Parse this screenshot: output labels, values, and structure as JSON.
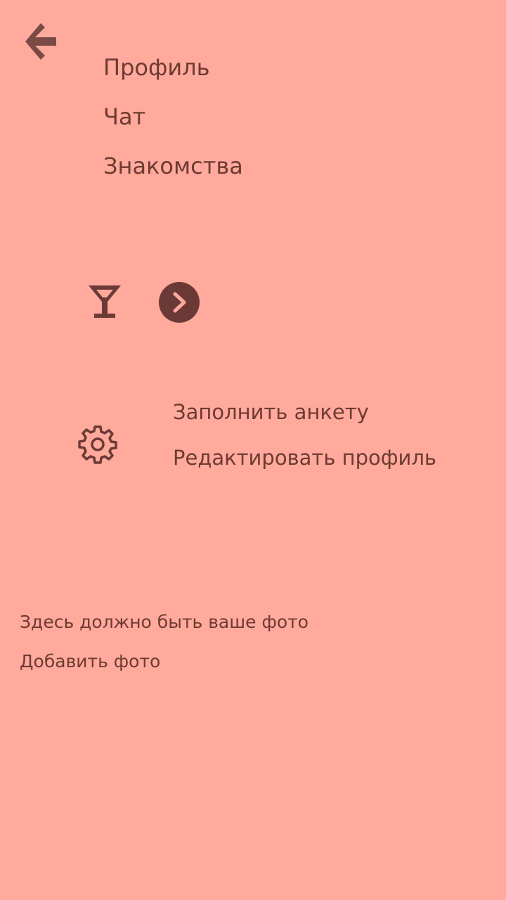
{
  "colors": {
    "background": "#ffaa9c",
    "text": "#6e3a33",
    "icon": "#7a4a44",
    "button_dark": "#6b3a36"
  },
  "header": {
    "back_icon": "arrow-left-icon"
  },
  "menu": {
    "items": [
      {
        "label": "Профиль"
      },
      {
        "label": "Чат"
      },
      {
        "label": "Знакомства"
      }
    ]
  },
  "dating": {
    "icon": "cocktail-icon",
    "next_icon": "chevron-right-icon"
  },
  "settings": {
    "icon": "gear-icon",
    "fill_form_label": "Заполнить анкету",
    "edit_profile_label": "Редактировать профиль"
  },
  "photo": {
    "placeholder_text": "Здесь должно быть ваше фото",
    "add_photo_label": "Добавить фото"
  }
}
